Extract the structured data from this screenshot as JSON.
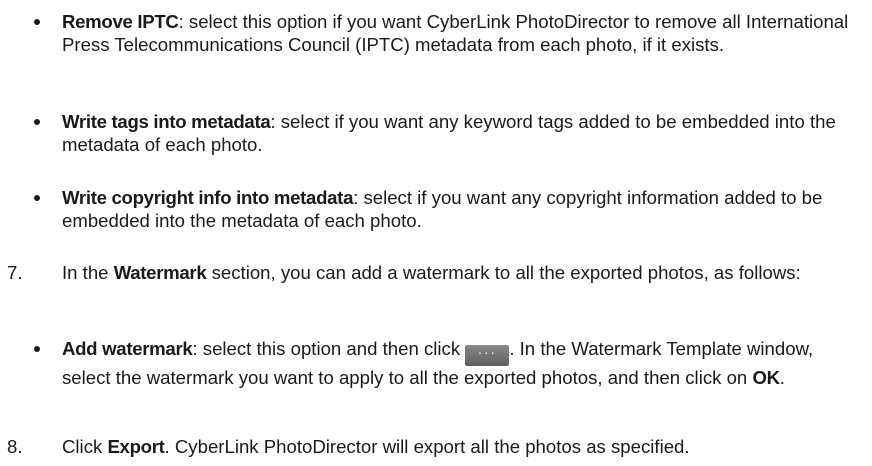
{
  "items": {
    "remove_iptc": {
      "title": "Remove IPTC",
      "text": ": select this option if you want CyberLink PhotoDirector to remove all International Press Telecommunications Council (IPTC) metadata from each photo, if it exists."
    },
    "write_tags": {
      "title": "Write tags into metadata",
      "text": ": select if you want any keyword tags added to be embedded into the metadata of each photo."
    },
    "write_copyright": {
      "title": "Write copyright info into metadata",
      "text": ": select if you want any copyright information added to be embedded into the metadata of each photo."
    },
    "step7": {
      "number": "7.",
      "text_before": "In the ",
      "bold": "Watermark",
      "text_after": " section, you can add a watermark to all the exported photos, as follows:"
    },
    "add_watermark": {
      "title": "Add watermark",
      "text_before": ": select this option and then click ",
      "button_label": "···",
      "text_after": ". In the Watermark Template window, select the watermark you want to apply to all the exported photos, and then click on ",
      "ok_label": "OK",
      "end": "."
    },
    "step8": {
      "number": "8.",
      "text_before": "Click ",
      "bold": "Export",
      "text_after": ". CyberLink PhotoDirector will export all the photos as specified."
    }
  }
}
